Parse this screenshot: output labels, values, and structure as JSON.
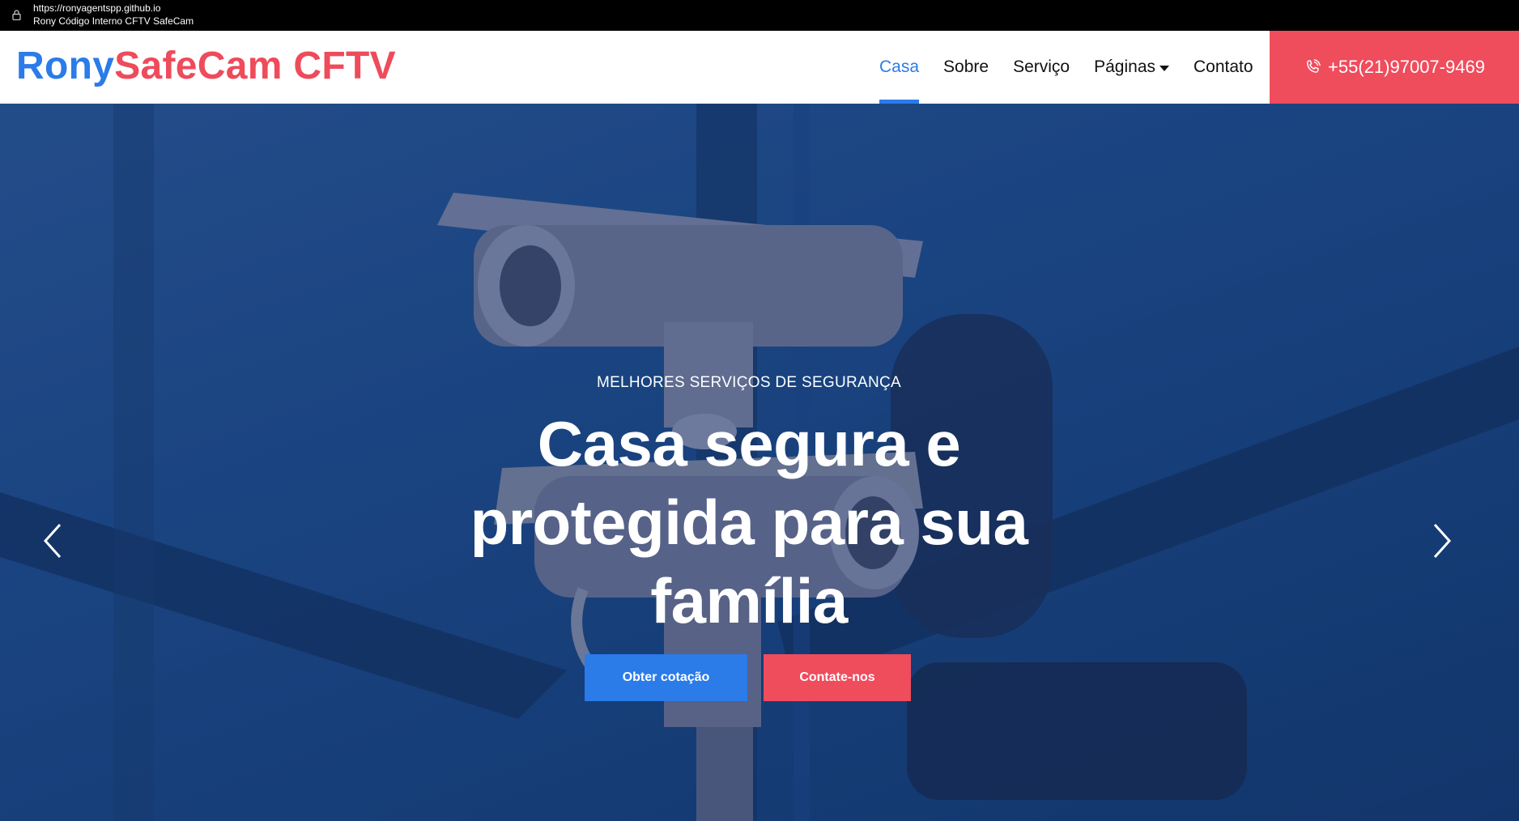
{
  "browser": {
    "url": "https://ronyagentspp.github.io",
    "tab_title": "Rony Código Interno CFTV SafeCam"
  },
  "brand": {
    "part1": "Rony",
    "part2": "SafeCam CFTV",
    "color_primary": "#2b7be9",
    "color_secondary": "#ee4b5b"
  },
  "nav": {
    "items": [
      {
        "label": "Casa",
        "active": true
      },
      {
        "label": "Sobre"
      },
      {
        "label": "Serviço"
      },
      {
        "label": "Páginas",
        "dropdown": true
      },
      {
        "label": "Contato"
      }
    ],
    "phone": "+55(21)97007-9469",
    "phone_icon": "phone-icon"
  },
  "hero": {
    "kicker": "MELHORES SERVIÇOS DE SEGURANÇA",
    "headline": "Casa segura e protegida para sua família",
    "buttons": {
      "quote": "Obter cotação",
      "contact": "Contate-nos"
    },
    "prev_icon": "chevron-left-icon",
    "next_icon": "chevron-right-icon"
  }
}
